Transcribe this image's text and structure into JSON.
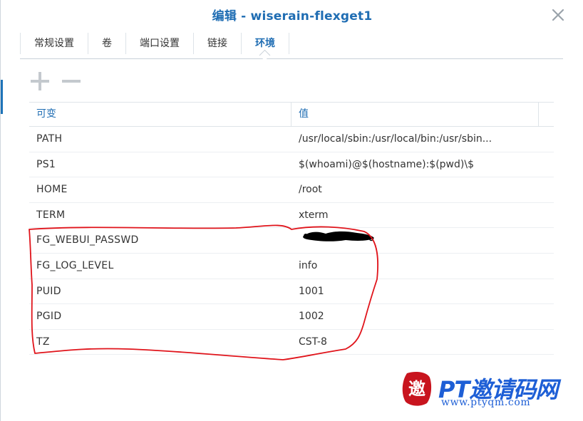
{
  "dialog": {
    "title": "编辑 - wiserain-flexget1"
  },
  "tabs": [
    {
      "label": "常规设置",
      "active": false
    },
    {
      "label": "卷",
      "active": false
    },
    {
      "label": "端口设置",
      "active": false
    },
    {
      "label": "链接",
      "active": false
    },
    {
      "label": "环境",
      "active": true
    }
  ],
  "toolbar": {
    "add_icon": "plus-icon",
    "remove_icon": "minus-icon"
  },
  "table": {
    "headers": [
      "可变",
      "值"
    ],
    "rows": [
      {
        "name": "PATH",
        "value": "/usr/local/sbin:/usr/local/bin:/usr/sbin..."
      },
      {
        "name": "PS1",
        "value": "$(whoami)@$(hostname):$(pwd)\\$"
      },
      {
        "name": "HOME",
        "value": "/root"
      },
      {
        "name": "TERM",
        "value": "xterm"
      },
      {
        "name": "FG_WEBUI_PASSWD",
        "value": ""
      },
      {
        "name": "FG_LOG_LEVEL",
        "value": "info"
      },
      {
        "name": "PUID",
        "value": "1001"
      },
      {
        "name": "PGID",
        "value": "1002"
      },
      {
        "name": "TZ",
        "value": "CST-8"
      }
    ]
  },
  "watermark": {
    "brand": "PT邀请码网",
    "url": "www.ptyqm.com",
    "seal_char": "邀"
  },
  "colors": {
    "accent": "#1f6db3",
    "annotation": "#e0141b",
    "watermark": "#1e5fd6",
    "seal": "#c8141e"
  }
}
